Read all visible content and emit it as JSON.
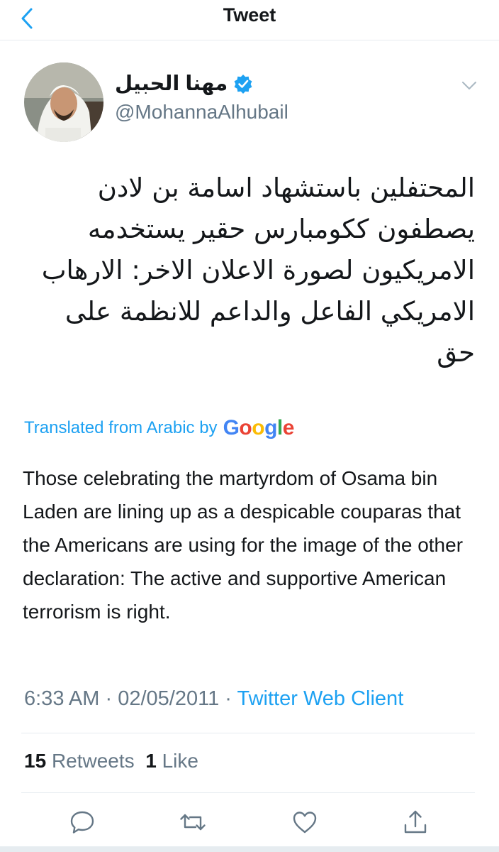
{
  "nav": {
    "title": "Tweet",
    "back_icon": "chevron-left-icon"
  },
  "author": {
    "display_name": "مهنا الحبيل",
    "handle": "@MohannaAlhubail",
    "verified": true
  },
  "tweet": {
    "text": "المحتفلين باستشهاد اسامة بن لادن\nيصطفون ككومبارس حقير يستخدمه\nالامريكيون لصورة الاعلان الاخر: الارهاب\nالامريكي الفاعل والداعم للانظمة على\nحق",
    "translated_label": "Translated from Arabic by",
    "translator": "Google",
    "translation": "Those celebrating the martyrdom of Osama bin Laden are lining up as a despicable couparas that the Americans are using for the image of the other declaration: The active and supportive American terrorism is right."
  },
  "meta": {
    "time": "6:33 AM",
    "separator": "·",
    "date": "02/05/2011",
    "client": "Twitter Web Client"
  },
  "stats": {
    "retweets_count": "15",
    "retweets_label": "Retweets",
    "likes_count": "1",
    "likes_label": "Like"
  },
  "actions": [
    "reply-icon",
    "retweet-icon",
    "like-icon",
    "share-icon"
  ],
  "colors": {
    "accent": "#1da1f2",
    "text": "#14171a",
    "secondary": "#657786",
    "divider": "#e6ecf0"
  }
}
